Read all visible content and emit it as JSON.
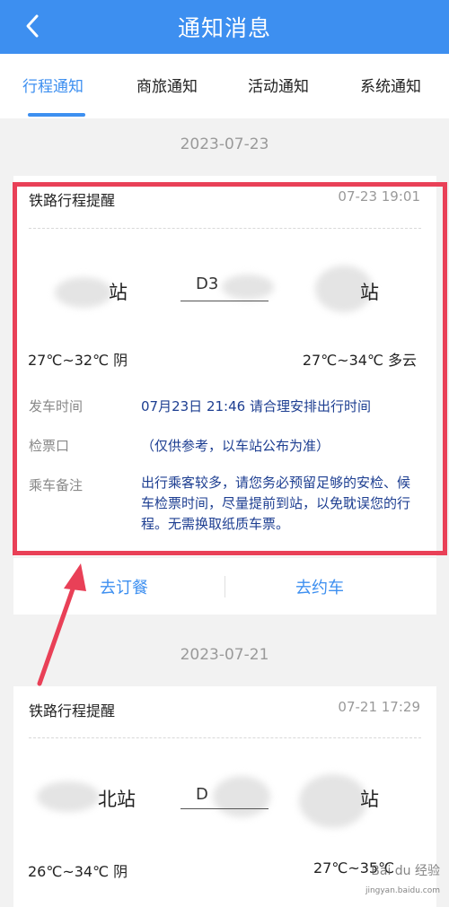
{
  "header": {
    "title": "通知消息",
    "back_icon": "chevron-left-icon"
  },
  "tabs": [
    {
      "label": "行程通知",
      "active": true
    },
    {
      "label": "商旅通知",
      "active": false
    },
    {
      "label": "活动通知",
      "active": false
    },
    {
      "label": "系统通知",
      "active": false
    }
  ],
  "cards": [
    {
      "date": "2023-07-23",
      "title": "铁路行程提醒",
      "time": "07-23 19:01",
      "from_station": "站",
      "to_station": "站",
      "train_no": "D3",
      "from_weather": "27℃~32℃ 阴",
      "to_weather": "27℃~34℃ 多云",
      "depart_label": "发车时间",
      "depart_value": "07月23日 21:46 请合理安排出行时间",
      "gate_label": "检票口",
      "gate_value": "（仅供参考，以车站公布为准）",
      "note_label": "乘车备注",
      "note_value": "出行乘客较多，请您务必预留足够的安检、候车检票时间，尽量提前到站，以免耽误您的行程。无需换取纸质车票。",
      "action_meal": "去订餐",
      "action_car": "去约车"
    },
    {
      "date": "2023-07-21",
      "title": "铁路行程提醒",
      "time": "07-21 17:29",
      "from_station": "北站",
      "to_station": "站",
      "train_no": "D",
      "from_weather": "26℃~34℃ 阴",
      "to_weather": "27℃~35℃"
    }
  ],
  "watermark": {
    "line1": "Bai du 经验",
    "line2": "jingyan.baidu.com"
  },
  "colors": {
    "primary": "#3d8ff0",
    "highlight": "#e94057",
    "info_text": "#1d3e91"
  }
}
